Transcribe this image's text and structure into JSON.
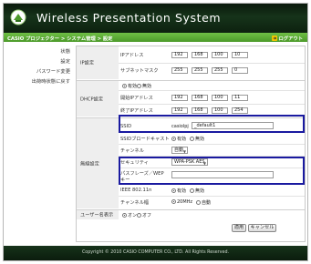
{
  "app": {
    "title": "Wireless Presentation System"
  },
  "nav": {
    "breadcrumb": "CASIO プロジェクター > システム管理 > 設定",
    "logout": "ログアウト"
  },
  "sidebar": {
    "items": [
      {
        "label": "状態"
      },
      {
        "label": "設定"
      },
      {
        "label": "パスワード変更"
      },
      {
        "label": "出荷時状態に戻す"
      }
    ]
  },
  "ip_section": {
    "label": "IP設定",
    "ip_label": "IPアドレス",
    "ip": [
      "192",
      "168",
      "100",
      "10"
    ],
    "mask_label": "サブネットマスク",
    "mask": [
      "255",
      "255",
      "255",
      "0"
    ]
  },
  "dhcp_section": {
    "label": "DHCP設定",
    "enable_label": "有効",
    "disable_label": "無効",
    "selected": "有効",
    "start_label": "開始IPアドレス",
    "start": [
      "192",
      "168",
      "100",
      "11"
    ],
    "end_label": "終了IPアドレス",
    "end": [
      "192",
      "168",
      "100",
      "254"
    ]
  },
  "wireless_section": {
    "label": "無線設定",
    "ssid_label": "SSID",
    "ssid_prefix": "casiolpj",
    "ssid_value": "_default1",
    "broadcast_label": "SSIDブロードキャスト",
    "broadcast_on": "有効",
    "broadcast_off": "無効",
    "broadcast_selected": "有効",
    "channel_label": "チャンネル",
    "channel_value": "自動",
    "security_label": "セキュリティ",
    "security_value": "WPA-PSK AES",
    "passphrase_label_1": "パスフレーズ／WEP",
    "passphrase_label_2": "キー",
    "passphrase_value": "",
    "ieee_label": "IEEE 802.11n",
    "ieee_on": "有効",
    "ieee_off": "無効",
    "ieee_selected": "有効",
    "bandwidth_label": "チャンネル幅",
    "bw_20": "20MHz",
    "bw_auto": "自動",
    "bw_selected": "20MHz"
  },
  "user_name_section": {
    "label": "ユーザー名表示",
    "on": "オン",
    "off": "オフ",
    "selected": "オン"
  },
  "buttons": {
    "apply": "適用",
    "cancel": "キャンセル"
  },
  "footer": {
    "copyright": "Copyright © 2010 CASIO COMPUTER CO., LTD. All Rights Reserved."
  },
  "colors": {
    "header_dark": "#0d210f",
    "crumb_green": "#5aa832",
    "highlight_blue": "#1a1aa0"
  }
}
